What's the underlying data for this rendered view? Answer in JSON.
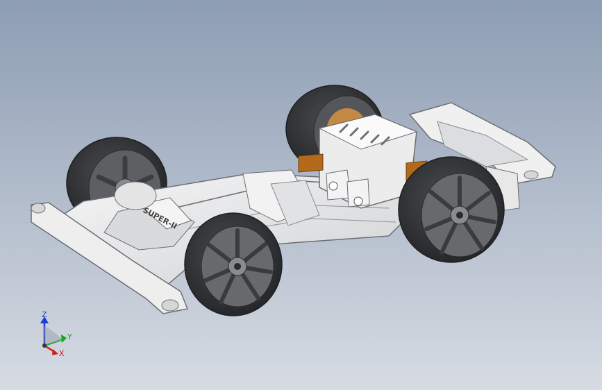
{
  "viewport": {
    "background_top": "#8d9db3",
    "background_bottom": "#d6dbe3"
  },
  "model": {
    "chassis_embossed_text": "SUPER-II",
    "colors": {
      "chassis": "#e9e9e9",
      "chassis_shade": "#bfc2c6",
      "chassis_edge": "#6b6e72",
      "tire": "#2c2d30",
      "tire_highlight": "#4a4c50",
      "rim": "#6a6b6e",
      "rim_dark": "#3c3d40",
      "bronze": "#b46a1c"
    }
  },
  "triad": {
    "z_label": "Z",
    "y_label": "Y",
    "x_label": "X",
    "colors": {
      "z": "#1d3fd0",
      "y": "#1aa51a",
      "x": "#d21a1a"
    }
  }
}
